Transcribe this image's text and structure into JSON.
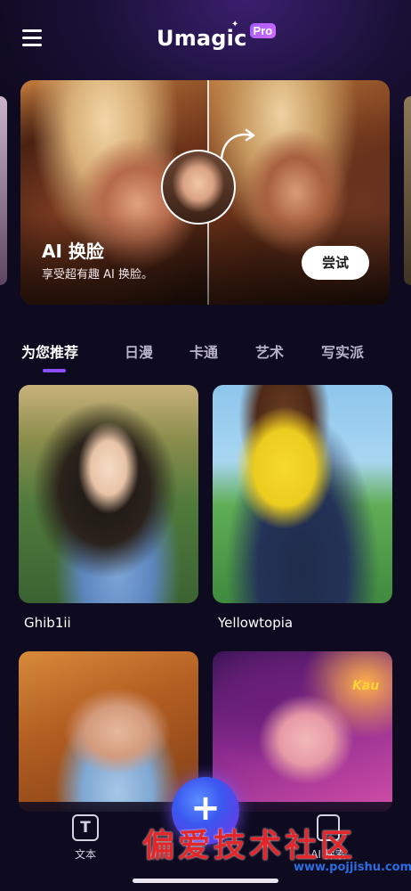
{
  "header": {
    "menu_icon": "hamburger-menu-icon",
    "logo_text": "Umagic",
    "logo_badge": "Pro"
  },
  "banner": {
    "title": "AI 换脸",
    "subtitle": "享受超有趣 AI 换脸。",
    "button_label": "尝试"
  },
  "tabs": [
    {
      "label": "为您推荐",
      "active": true
    },
    {
      "label": "日漫",
      "active": false
    },
    {
      "label": "卡通",
      "active": false
    },
    {
      "label": "艺术",
      "active": false
    },
    {
      "label": "写实派",
      "active": false
    }
  ],
  "cards": [
    {
      "label": "Ghib1ii"
    },
    {
      "label": "Yellowtopia"
    },
    {
      "label": ""
    },
    {
      "label": ""
    }
  ],
  "card_overlay_text": "Kau",
  "bottom_nav": {
    "text_label": "文本",
    "text_icon": "T",
    "ai_label": "AI 探索",
    "fab_icon": "+"
  },
  "watermark": {
    "text": "偏爱技术社区",
    "url": "www.pojjishu.com"
  },
  "colors": {
    "background": "#0e0a1f",
    "accent": "#8a4dff",
    "fab_blue": "#3b57f0",
    "pro_badge": "#a35bff"
  }
}
